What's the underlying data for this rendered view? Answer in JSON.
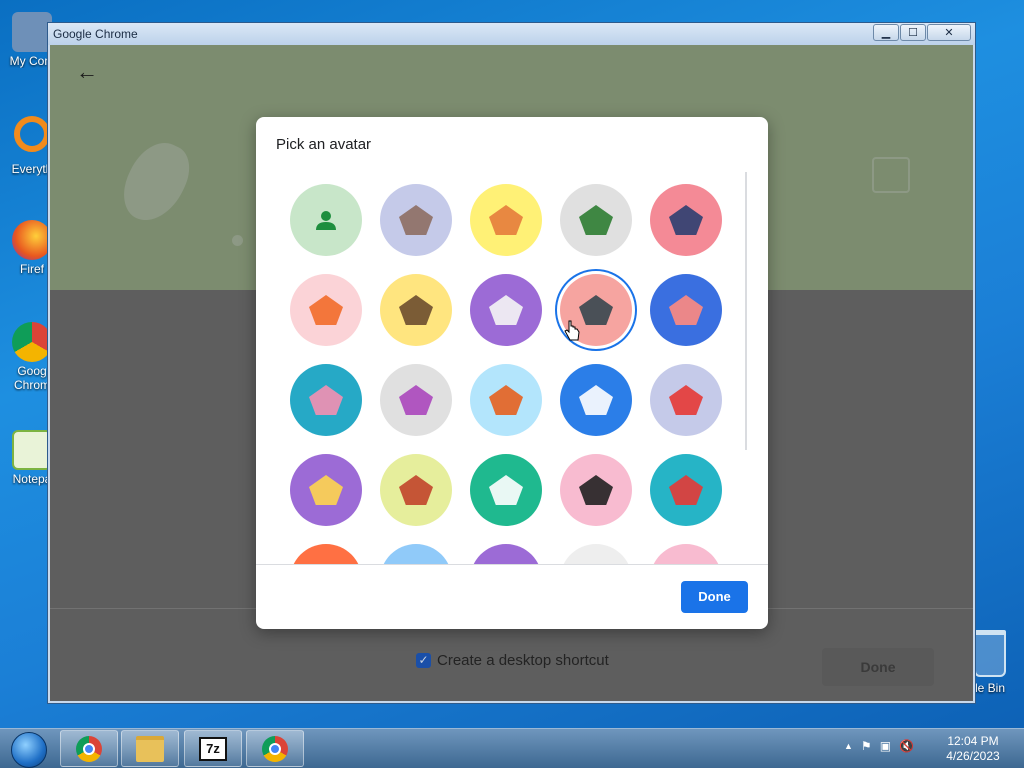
{
  "desktop": {
    "icons": [
      {
        "label": "My Com",
        "color": "#5a7fa8"
      },
      {
        "label": "Everyth",
        "color": "#f28b1c"
      },
      {
        "label": "Firef",
        "color": "#e8571f"
      },
      {
        "label": "Goog Chrom",
        "color": "#db4437"
      },
      {
        "label": "Notepa",
        "color": "#7cb342"
      }
    ],
    "recycle_bin_label": "le Bin"
  },
  "window": {
    "title": "Google Chrome",
    "minimize": "▁",
    "maximize": "☐",
    "close": "✕",
    "back": "←",
    "shortcut_label": "Create a desktop shortcut",
    "shortcut_checked": true,
    "shortcut_check_glyph": "✓",
    "background_done_label": "Done"
  },
  "dialog": {
    "title": "Pick an avatar",
    "done_label": "Done",
    "avatars": [
      {
        "name": "default-person",
        "bg": "#c8e6c9",
        "fg": "#1e8e3e",
        "selected": false
      },
      {
        "name": "origami-cat",
        "bg": "#c5cae9",
        "fg": "#8d6e63",
        "selected": false
      },
      {
        "name": "origami-corgi",
        "bg": "#fff176",
        "fg": "#e67c3c",
        "selected": false
      },
      {
        "name": "origami-dragon",
        "bg": "#e0e0e0",
        "fg": "#2e7d32",
        "selected": false
      },
      {
        "name": "origami-elephant",
        "bg": "#f48a96",
        "fg": "#2c3e70",
        "selected": false
      },
      {
        "name": "origami-fox",
        "bg": "#fbd3d7",
        "fg": "#f26b2a",
        "selected": false
      },
      {
        "name": "origami-monkey",
        "bg": "#ffe57f",
        "fg": "#6d4c2f",
        "selected": false
      },
      {
        "name": "origami-panda",
        "bg": "#9c6bd6",
        "fg": "#f5f5f5",
        "selected": false
      },
      {
        "name": "origami-penguin",
        "bg": "#f6a4a0",
        "fg": "#37474f",
        "selected": true
      },
      {
        "name": "origami-butterfly",
        "bg": "#3a6fe0",
        "fg": "#ff8a80",
        "selected": false
      },
      {
        "name": "origami-rabbit",
        "bg": "#26a9c6",
        "fg": "#f48fb1",
        "selected": false
      },
      {
        "name": "origami-unicorn",
        "bg": "#e0e0e0",
        "fg": "#ab47bc",
        "selected": false
      },
      {
        "name": "basketball",
        "bg": "#b3e5fc",
        "fg": "#e6601f",
        "selected": false
      },
      {
        "name": "bicycle",
        "bg": "#2b7ee8",
        "fg": "#ffffff",
        "selected": false
      },
      {
        "name": "bird",
        "bg": "#c5cae9",
        "fg": "#e53935",
        "selected": false
      },
      {
        "name": "cheese",
        "bg": "#9c6bd6",
        "fg": "#ffd54f",
        "selected": false
      },
      {
        "name": "football",
        "bg": "#e6ee9c",
        "fg": "#c1442b",
        "selected": false
      },
      {
        "name": "ramen",
        "bg": "#1fb98f",
        "fg": "#ffffff",
        "selected": false
      },
      {
        "name": "sunglasses",
        "bg": "#f8bbd0",
        "fg": "#212121",
        "selected": false
      },
      {
        "name": "sushi",
        "bg": "#26b4c6",
        "fg": "#e53935",
        "selected": false
      },
      {
        "name": "partial-1",
        "bg": "#ff7043",
        "fg": "#ffffff",
        "selected": false
      },
      {
        "name": "partial-2",
        "bg": "#90caf9",
        "fg": "#212121",
        "selected": false
      },
      {
        "name": "partial-3",
        "bg": "#9c6bd6",
        "fg": "#ffe082",
        "selected": false
      },
      {
        "name": "partial-4",
        "bg": "#eeeeee",
        "fg": "#ff5722",
        "selected": false
      },
      {
        "name": "partial-5",
        "bg": "#f8bbd0",
        "fg": "#e53935",
        "selected": false
      }
    ]
  },
  "taskbar": {
    "apps": [
      "chrome",
      "explorer",
      "7zip",
      "chrome"
    ],
    "sevenzip_label": "7z",
    "tray_glyphs": [
      "▲",
      "⚑",
      "▣",
      "🔇"
    ],
    "time": "12:04 PM",
    "date": "4/26/2023"
  },
  "colors": {
    "accent": "#1a73e8",
    "banner": "#7c8c6f"
  }
}
